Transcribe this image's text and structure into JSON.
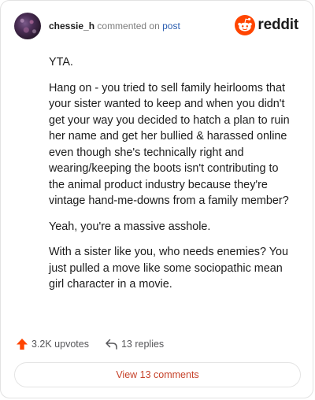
{
  "header": {
    "username": "chessie_h",
    "action_text": "commented on",
    "post_link": "post",
    "brand_name": "reddit"
  },
  "comment": {
    "paragraphs": [
      "YTA.",
      "Hang on - you tried to sell family heirlooms that your sister wanted to keep and when you didn't get your way you decided to hatch a plan to ruin her name and get her bullied & harassed online even though she's technically right and wearing/keeping the boots isn't contributing to the animal product industry because they're vintage hand-me-downs from a family member?",
      "Yeah, you're a massive asshole.",
      "With a sister like you, who needs enemies? You just pulled a move like some sociopathic mean girl character in a movie."
    ]
  },
  "actions": {
    "upvotes_label": "3.2K upvotes",
    "replies_label": "13 replies",
    "upvote_icon": "upvote-arrow-icon",
    "reply_icon": "reply-arrow-icon"
  },
  "footer": {
    "view_comments_label": "View 13 comments"
  },
  "colors": {
    "accent": "#ff4500",
    "link": "#2a5db0",
    "view_button_text": "#c6422a"
  }
}
